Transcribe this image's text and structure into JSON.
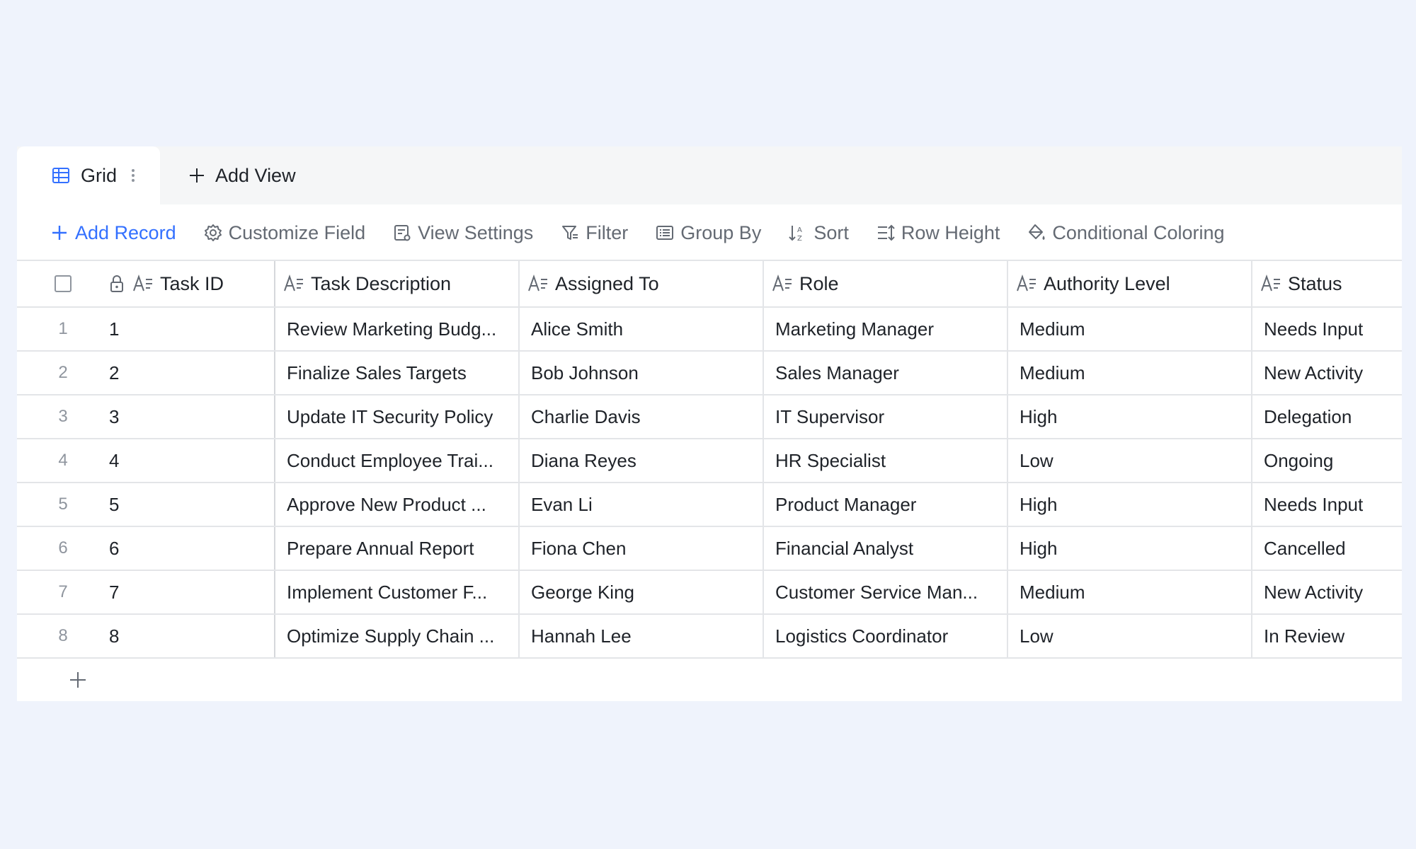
{
  "tabs": {
    "active": "Grid",
    "add_view": "Add View"
  },
  "toolbar": {
    "add_record": "Add Record",
    "customize_field": "Customize Field",
    "view_settings": "View Settings",
    "filter": "Filter",
    "group_by": "Group By",
    "sort": "Sort",
    "row_height": "Row Height",
    "conditional_coloring": "Conditional Coloring"
  },
  "columns": {
    "task_id": "Task ID",
    "task_description": "Task Description",
    "assigned_to": "Assigned To",
    "role": "Role",
    "authority_level": "Authority Level",
    "status": "Status"
  },
  "rows": [
    {
      "index": "1",
      "task_id": "1",
      "task_description": "Review Marketing Budg...",
      "assigned_to": "Alice Smith",
      "role": "Marketing Manager",
      "authority_level": "Medium",
      "status": "Needs Input"
    },
    {
      "index": "2",
      "task_id": "2",
      "task_description": "Finalize Sales Targets",
      "assigned_to": "Bob Johnson",
      "role": "Sales Manager",
      "authority_level": "Medium",
      "status": "New Activity"
    },
    {
      "index": "3",
      "task_id": "3",
      "task_description": "Update IT Security Policy",
      "assigned_to": "Charlie Davis",
      "role": "IT Supervisor",
      "authority_level": "High",
      "status": "Delegation"
    },
    {
      "index": "4",
      "task_id": "4",
      "task_description": "Conduct Employee Trai...",
      "assigned_to": "Diana Reyes",
      "role": "HR Specialist",
      "authority_level": "Low",
      "status": "Ongoing"
    },
    {
      "index": "5",
      "task_id": "5",
      "task_description": "Approve New Product ...",
      "assigned_to": "Evan Li",
      "role": "Product Manager",
      "authority_level": "High",
      "status": "Needs Input"
    },
    {
      "index": "6",
      "task_id": "6",
      "task_description": "Prepare Annual Report",
      "assigned_to": "Fiona Chen",
      "role": "Financial Analyst",
      "authority_level": "High",
      "status": "Cancelled"
    },
    {
      "index": "7",
      "task_id": "7",
      "task_description": "Implement Customer F...",
      "assigned_to": "George King",
      "role": "Customer Service Man...",
      "authority_level": "Medium",
      "status": "New Activity"
    },
    {
      "index": "8",
      "task_id": "8",
      "task_description": "Optimize Supply Chain ...",
      "assigned_to": "Hannah Lee",
      "role": "Logistics Coordinator",
      "authority_level": "Low",
      "status": "In Review"
    }
  ],
  "colors": {
    "accent": "#3370ff",
    "background": "#eff3fc",
    "border": "#e3e5e8",
    "muted_text": "#646a73"
  },
  "icons": {
    "grid_tab": "grid-view-icon",
    "text_field": "text-field-icon",
    "primary_lock": "lock-icon"
  }
}
